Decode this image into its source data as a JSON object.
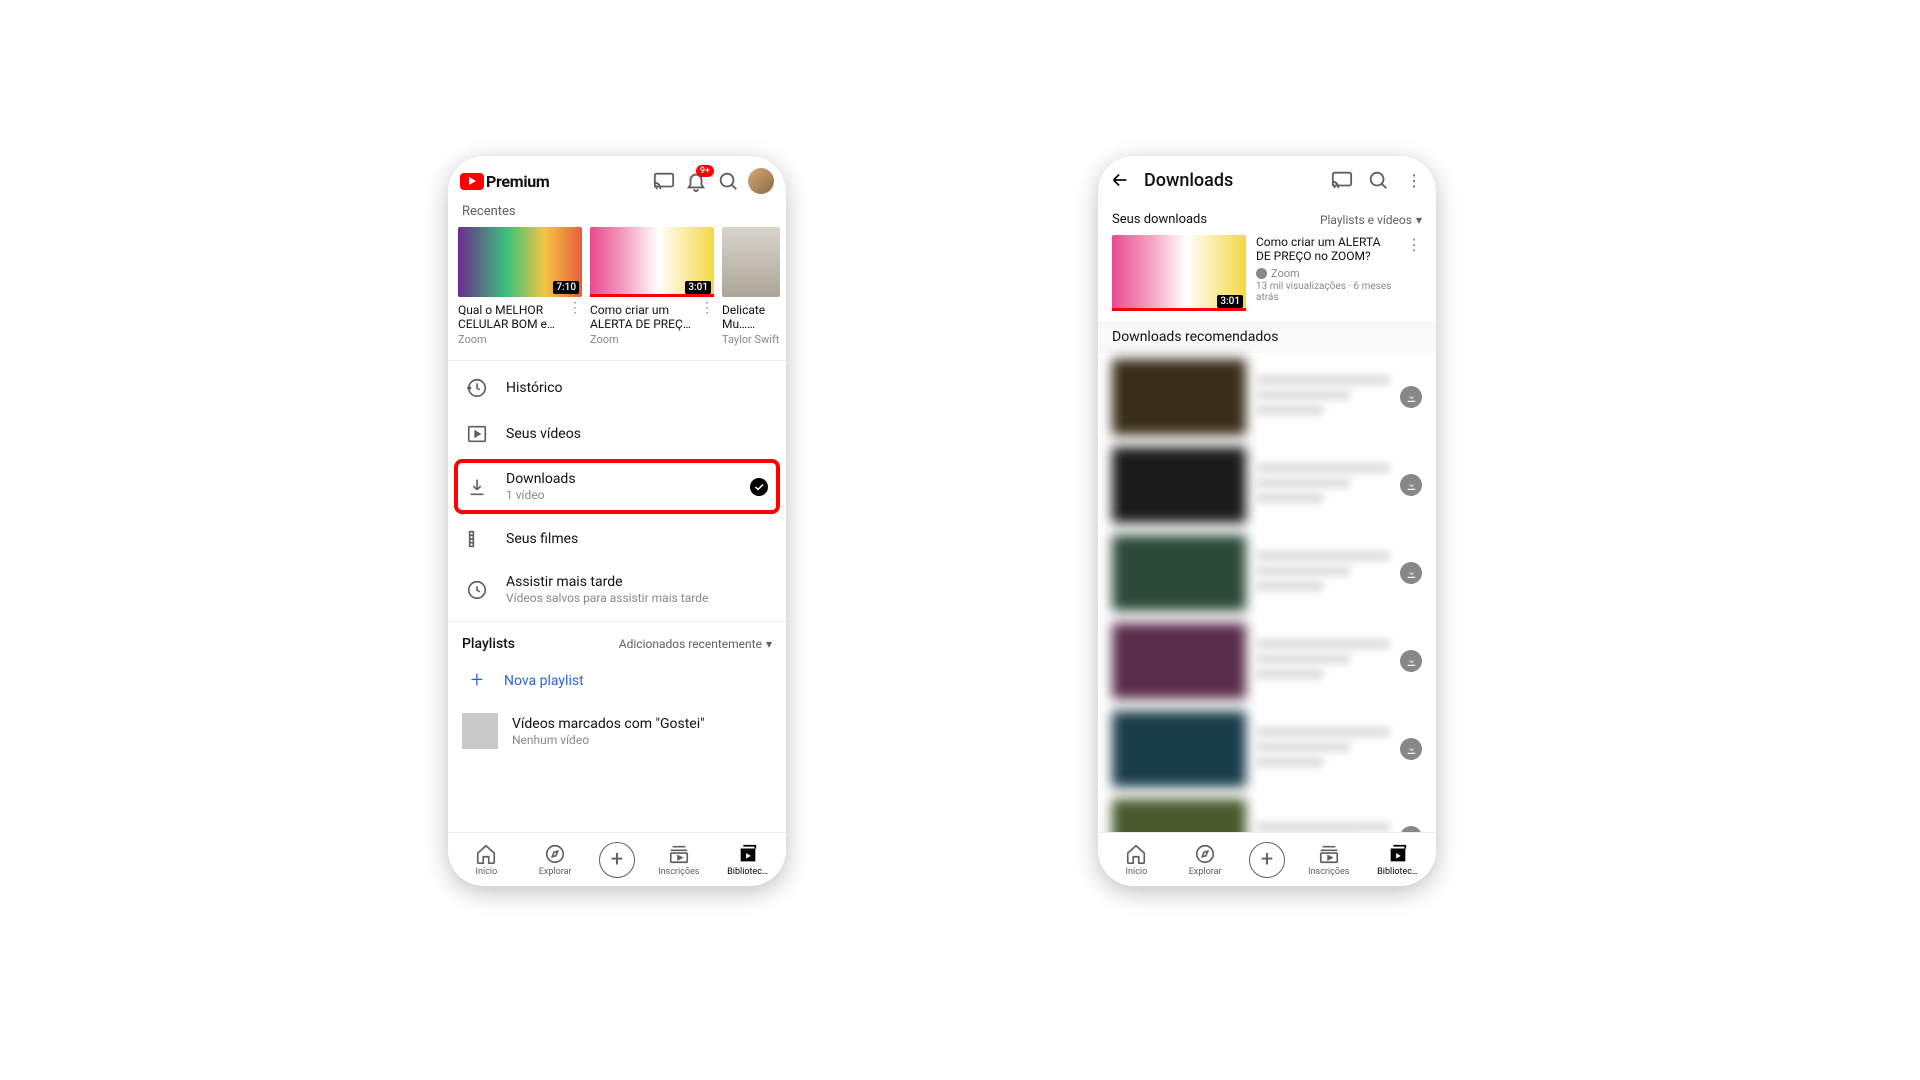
{
  "left": {
    "header": {
      "brand": "Premium",
      "notif_badge": "9+"
    },
    "recents_label": "Recentes",
    "recents": [
      {
        "title": "Qual o MELHOR CELULAR BOM e B…",
        "channel": "Zoom",
        "duration": "7:10"
      },
      {
        "title": "Como criar um ALERTA DE PREÇO …",
        "channel": "Zoom",
        "duration": "3:01"
      },
      {
        "title": "Delicate Mu… Dance Rehe…",
        "channel": "Taylor Swift",
        "duration": ""
      }
    ],
    "library": {
      "history": "Histórico",
      "your_videos": "Seus vídeos",
      "downloads": {
        "title": "Downloads",
        "sub": "1 vídeo"
      },
      "your_movies": "Seus filmes",
      "watch_later": {
        "title": "Assistir mais tarde",
        "sub": "Vídeos salvos para assistir mais tarde"
      }
    },
    "playlists": {
      "header": "Playlists",
      "sort": "Adicionados recentemente",
      "new": "Nova playlist",
      "liked": {
        "title": "Vídeos marcados com \"Gostei\"",
        "sub": "Nenhum vídeo"
      }
    }
  },
  "right": {
    "header_title": "Downloads",
    "your_downloads": "Seus downloads",
    "filter": "Playlists e vídeos",
    "video": {
      "title": "Como criar um ALERTA DE PREÇO no ZOOM?",
      "channel": "Zoom",
      "views": "13 mil visualizações",
      "age": "6 meses atrás",
      "duration": "3:01"
    },
    "recommended_label": "Downloads recomendados"
  },
  "bottom_nav": {
    "home": "Início",
    "explore": "Explorar",
    "subs": "Inscrições",
    "library": "Bibliotec…"
  }
}
